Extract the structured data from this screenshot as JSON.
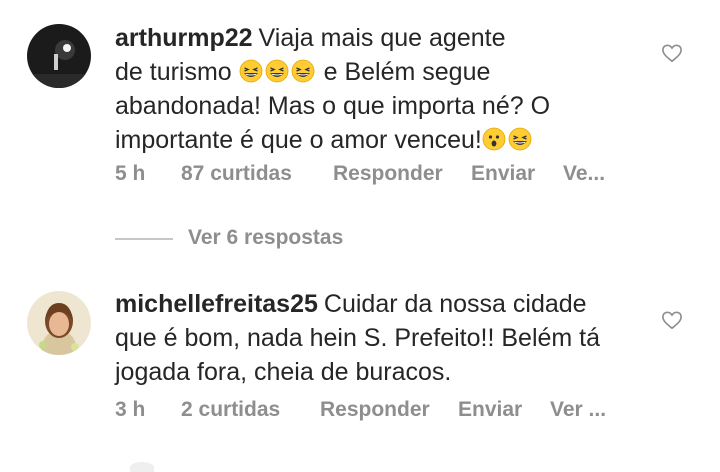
{
  "comments": [
    {
      "username": "arthurmp22",
      "text_line1": "Viaja mais que agente",
      "text_line2_start": "de turismo",
      "text_line2_end": "e Belém segue",
      "text_line3": "abandonada! Mas o que importa né? O",
      "text_line4": "importante é que o amor venceu!",
      "time": "5 h",
      "likes": "87 curtidas",
      "reply": "Responder",
      "send": "Enviar",
      "more": "Ve..."
    },
    {
      "username": "michellefreitas25",
      "text_line1": "Cuidar da nossa cidade",
      "text_line2": "que é bom, nada hein S. Prefeito!! Belém tá",
      "text_line3": "jogada fora, cheia de buracos.",
      "time": "3 h",
      "likes": "2 curtidas",
      "reply": "Responder",
      "send": "Enviar",
      "more": "Ver ..."
    }
  ],
  "view_replies": "Ver 6 respostas",
  "icons": {
    "like": "heart-outline-icon",
    "emoji_laugh": "grinning-squinting-face-icon",
    "emoji_surprised": "hushed-face-icon"
  },
  "colors": {
    "text": "#262626",
    "meta": "#8e8e8e",
    "emoji_yellow": "#ffcc33"
  }
}
